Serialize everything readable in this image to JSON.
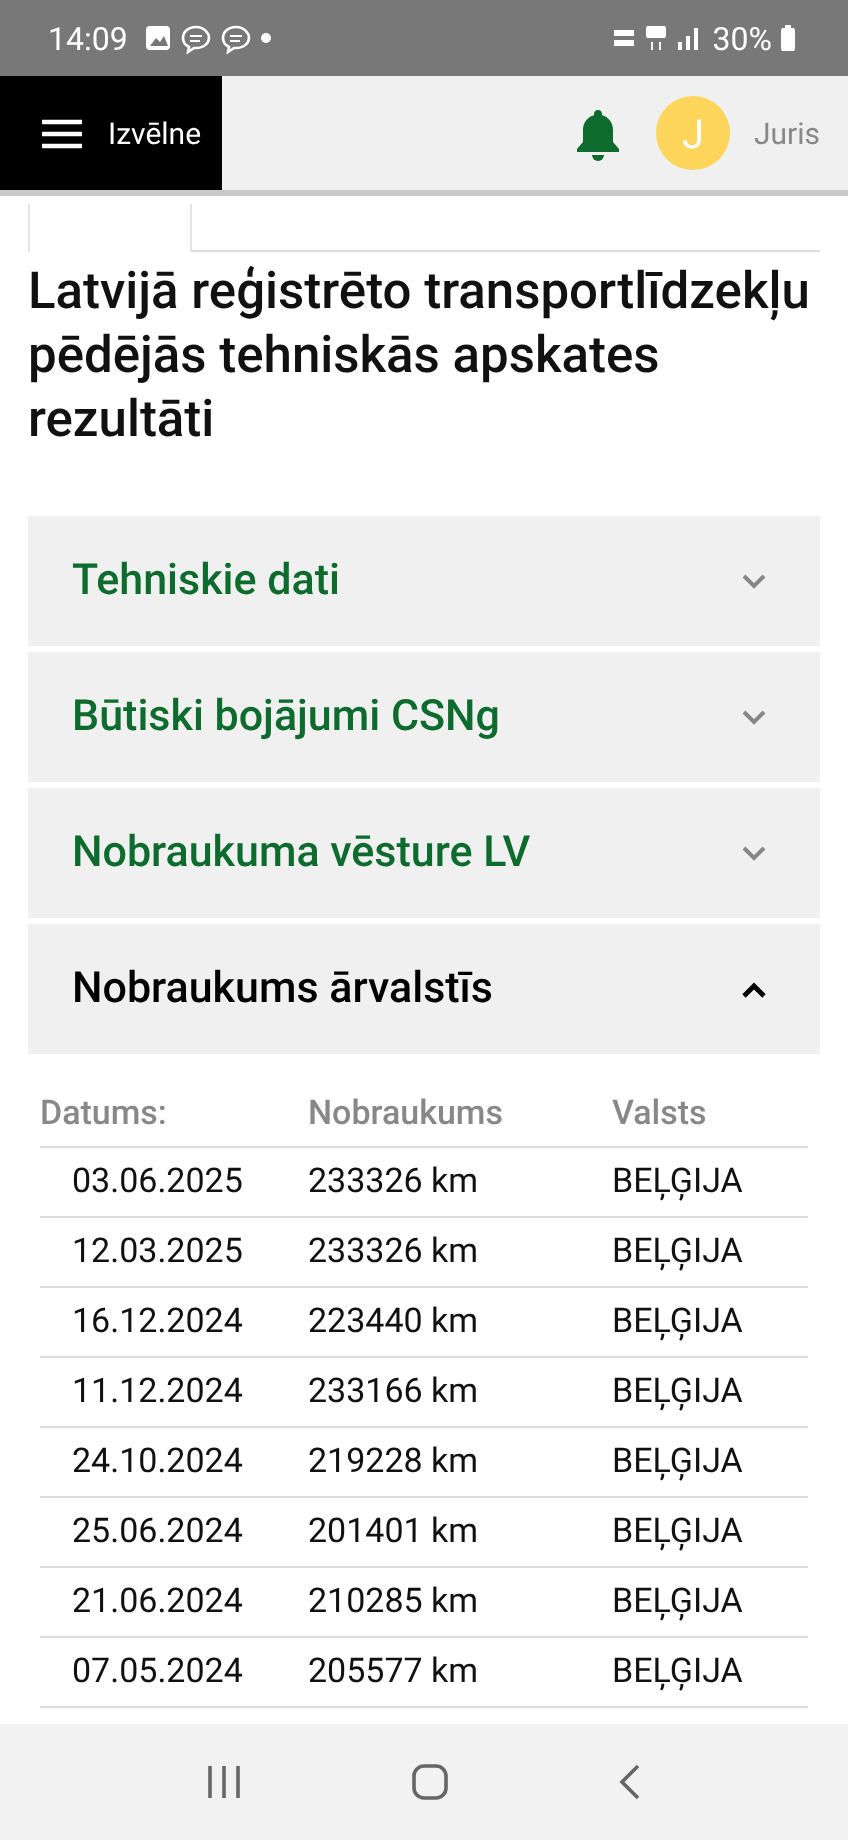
{
  "status_bar": {
    "time": "14:09",
    "battery": "30%"
  },
  "header": {
    "menu_label": "Izvēlne",
    "avatar_letter": "J",
    "user_name": "Juris"
  },
  "title": "Latvijā reģistrēto transportlīdzekļu pēdējās tehniskās apskates rezultāti",
  "sections": [
    {
      "title": "Tehniskie dati",
      "expanded": false
    },
    {
      "title": "Būtiski bojājumi CSNg",
      "expanded": false
    },
    {
      "title": "Nobraukuma vēsture LV",
      "expanded": false
    },
    {
      "title": "Nobraukums ārvalstīs",
      "expanded": true
    }
  ],
  "table": {
    "columns": [
      "Datums:",
      "Nobraukums",
      "Valsts"
    ],
    "rows": [
      [
        "03.06.2025",
        "233326 km",
        "BEĻĢIJA"
      ],
      [
        "12.03.2025",
        "233326 km",
        "BEĻĢIJA"
      ],
      [
        "16.12.2024",
        "223440 km",
        "BEĻĢIJA"
      ],
      [
        "11.12.2024",
        "233166 km",
        "BEĻĢIJA"
      ],
      [
        "24.10.2024",
        "219228 km",
        "BEĻĢIJA"
      ],
      [
        "25.06.2024",
        "201401 km",
        "BEĻĢIJA"
      ],
      [
        "21.06.2024",
        "210285 km",
        "BEĻĢIJA"
      ],
      [
        "07.05.2024",
        "205577 km",
        "BEĻĢIJA"
      ]
    ]
  }
}
